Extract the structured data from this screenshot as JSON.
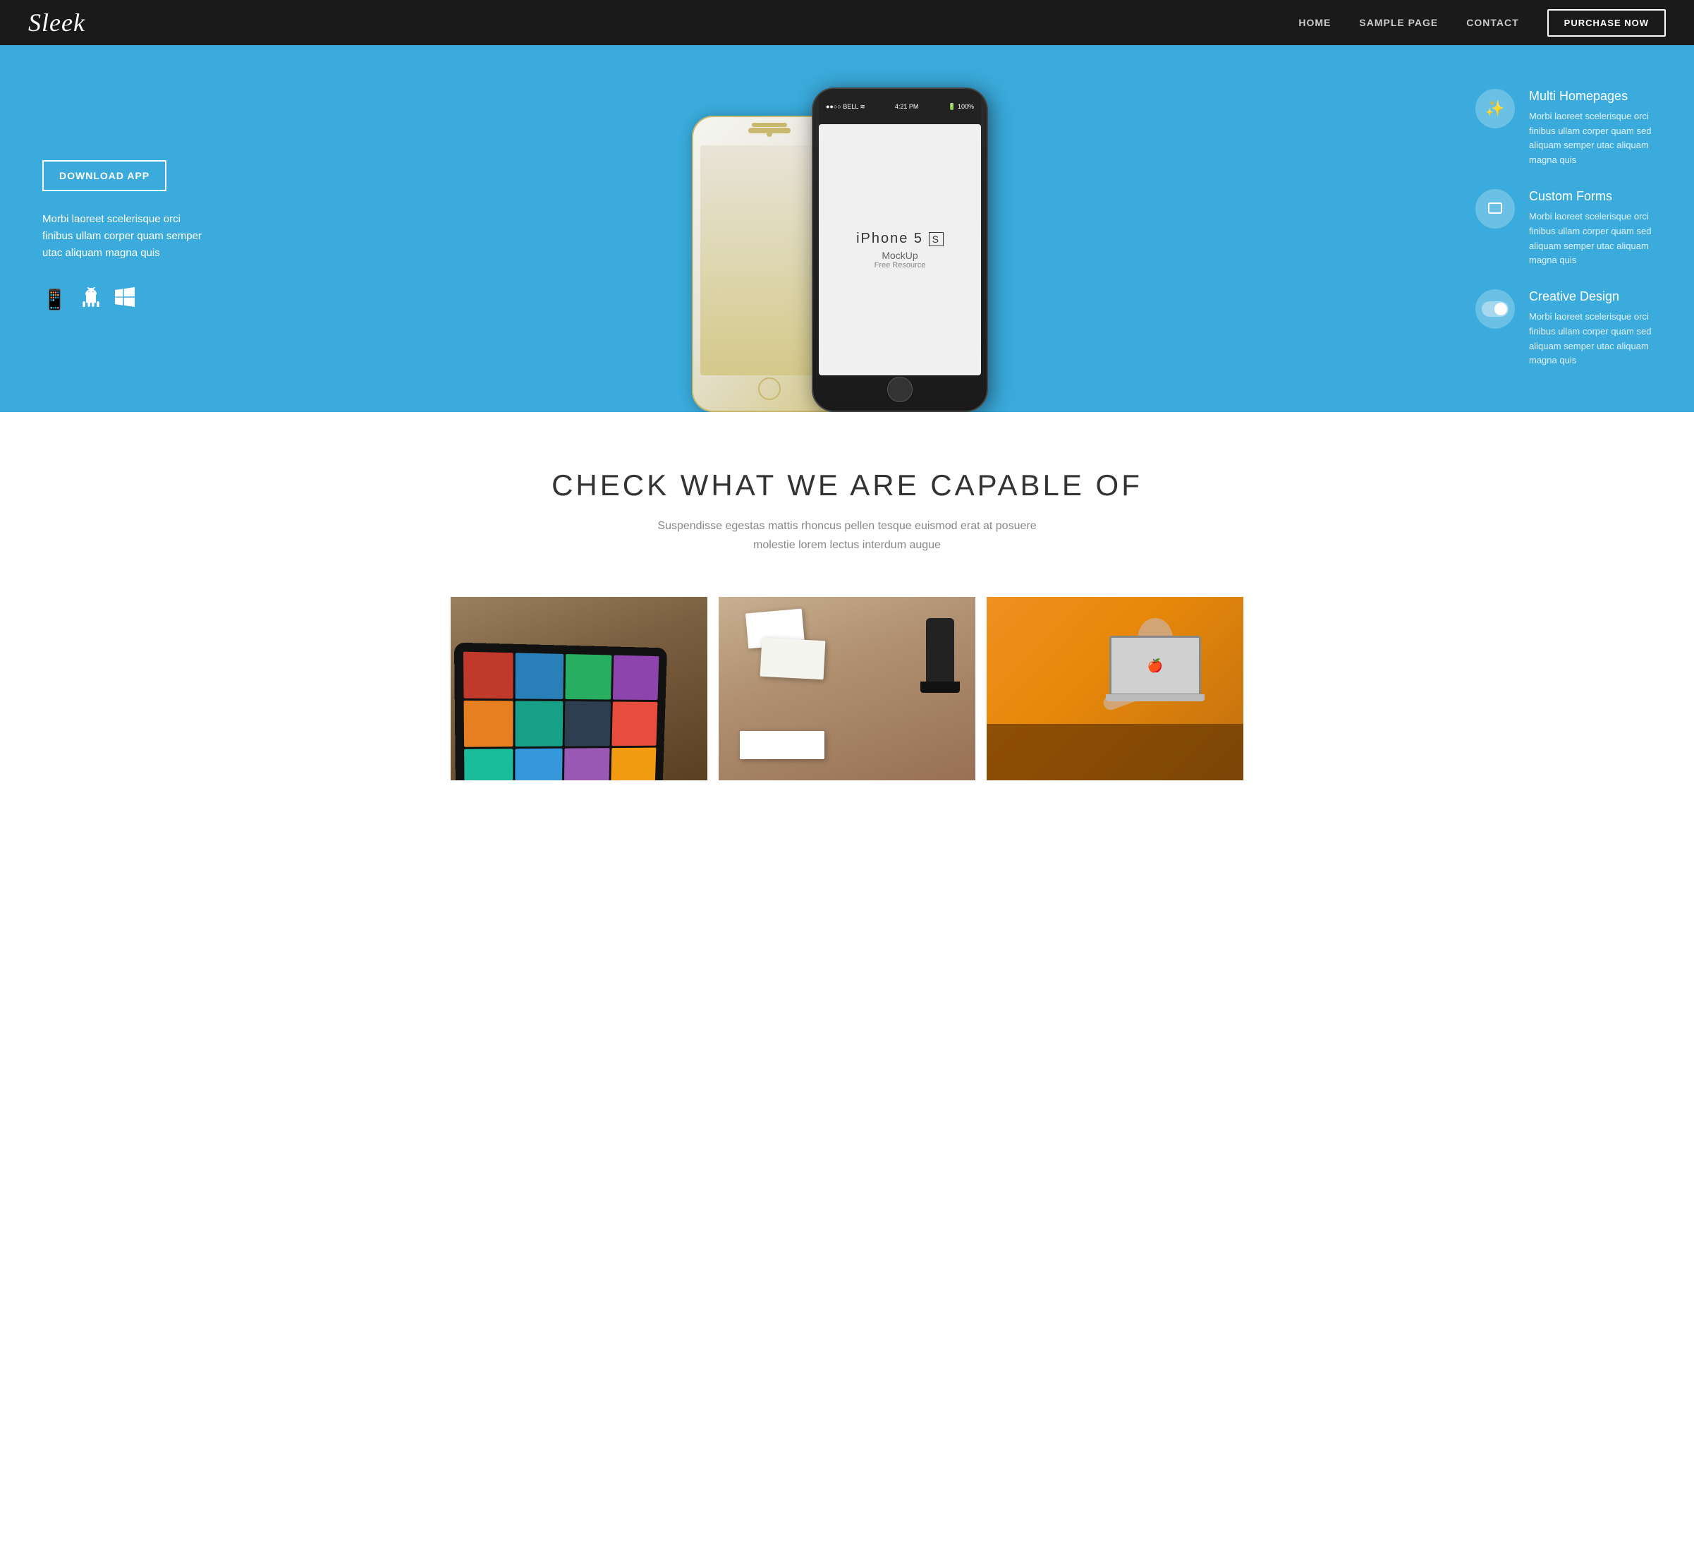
{
  "nav": {
    "logo": "Sleek",
    "links": [
      {
        "id": "home",
        "label": "HOME"
      },
      {
        "id": "sample-page",
        "label": "SAMPLE PAGE"
      },
      {
        "id": "contact",
        "label": "CONTACT"
      }
    ],
    "purchase_label": "PURCHASE NOW"
  },
  "hero": {
    "download_label": "DOWNLOAD APP",
    "description": "Morbi laoreet scelerisque orci finibus ullam corper quam semper utac aliquam magna quis",
    "platforms": [
      {
        "id": "ios",
        "icon": "📱",
        "label": "iOS"
      },
      {
        "id": "android",
        "icon": "🤖",
        "label": "Android"
      },
      {
        "id": "windows",
        "icon": "⊞",
        "label": "Windows"
      }
    ],
    "phone_model": "iPhone 5",
    "phone_variant": "S",
    "phone_subtitle": "MockUp",
    "phone_sub2": "Free Resource",
    "features": [
      {
        "id": "multi-homepages",
        "icon": "✨",
        "title": "Multi Homepages",
        "description": "Morbi laoreet scelerisque orci finibus ullam corper quam sed aliquam semper utac aliquam magna quis"
      },
      {
        "id": "custom-forms",
        "icon": "⬜",
        "title": "Custom Forms",
        "description": "Morbi laoreet scelerisque orci finibus ullam corper quam sed aliquam semper utac aliquam magna quis"
      },
      {
        "id": "creative-design",
        "icon": "◎",
        "title": "Creative Design",
        "description": "Morbi laoreet scelerisque orci finibus ullam corper quam sed aliquam semper utac aliquam magna quis"
      }
    ]
  },
  "capabilities": {
    "heading": "CHECK WHAT WE ARE CAPABLE OF",
    "subtext": "Suspendisse egestas mattis rhoncus pellen tesque euismod erat at posuere molestie lorem lectus interdum augue",
    "cards": [
      {
        "id": "tablet-card",
        "type": "tablet"
      },
      {
        "id": "office-card",
        "type": "office"
      },
      {
        "id": "laptop-card",
        "type": "laptop"
      }
    ]
  },
  "colors": {
    "nav_bg": "#1a1a1a",
    "hero_bg": "#3aabdc",
    "white": "#ffffff",
    "accent_orange": "#e8880a",
    "text_dark": "#333333",
    "text_muted": "#888888"
  }
}
